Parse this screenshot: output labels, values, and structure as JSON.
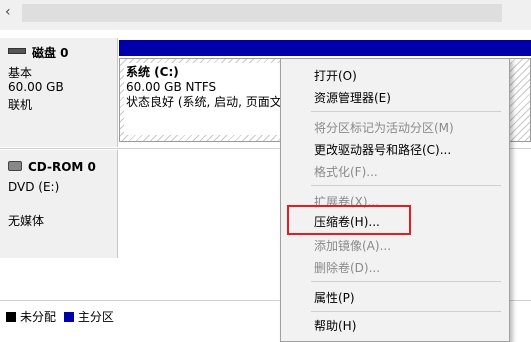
{
  "scroll": {
    "left_arrow": "‹"
  },
  "disk0": {
    "title": "磁盘 0",
    "type": "基本",
    "size": "60.00 GB",
    "status": "联机",
    "icon": "disk-icon",
    "partition": {
      "name": "系统  (C:)",
      "fs": "60.00 GB NTFS",
      "state": "状态良好 (系统, 启动, 页面文"
    }
  },
  "cdrom": {
    "title": "CD-ROM 0",
    "drive": "DVD (E:)",
    "media": "无媒体",
    "icon": "cdrom-icon"
  },
  "legend": {
    "unallocated": "未分配",
    "primary": "主分区",
    "colors": {
      "unallocated": "#000000",
      "primary": "#0000aa"
    }
  },
  "menu": {
    "open": "打开(O)",
    "explorer": "资源管理器(E)",
    "mark_active": "将分区标记为活动分区(M)",
    "change_letter": "更改驱动器号和路径(C)...",
    "format": "格式化(F)...",
    "extend": "扩展卷(X)...",
    "shrink": "压缩卷(H)...",
    "add_mirror": "添加镜像(A)...",
    "delete": "删除卷(D)...",
    "properties": "属性(P)",
    "help": "帮助(H)"
  },
  "colors": {
    "highlight_border": "#e02020",
    "disk_bar": "#0000aa"
  }
}
